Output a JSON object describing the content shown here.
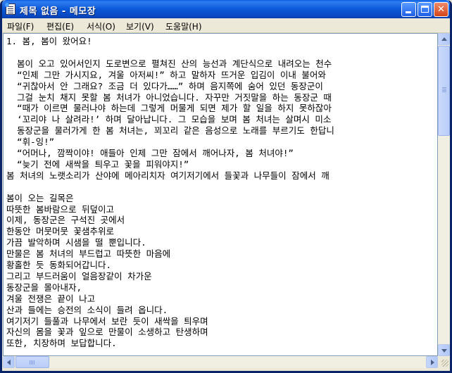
{
  "window": {
    "title": "제목 없음 - 메모장",
    "buttons": {
      "minimize": "",
      "maximize": "",
      "close": "✕"
    }
  },
  "menu": [
    {
      "label": "파일(F)"
    },
    {
      "label": "편집(E)"
    },
    {
      "label": "서식(O)"
    },
    {
      "label": "보기(V)"
    },
    {
      "label": "도움말(H)"
    }
  ],
  "editor": {
    "lines": [
      "1. 봄, 봄이 왔어요!",
      "",
      "  봄이 오고 있어서인지 도로변으로 펼쳐진 산의 능선과 계단식으로 내려오는 천수",
      "  “인제 그만 가시지요, 겨울 아저씨!” 하고 말하자 뜨거운 입김이 이내 불어와 ",
      "  “귀찮아서 안 그래요? 조금 더 있다가……” 하며 음지쪽에 숨어 있던 동장군이",
      "  그걸 눈치 채지 못할 봄 처녀가 아니었습니다. 자꾸만 거짓말을 하는 동장군 때",
      "  “때가 이르면 물러나야 하는데 그렇게 머물게 되면 제가 할 일을 하지 못하잖아",
      "  ‘꼬리야 나 살려라!’ 하며 달아납니다. 그 모습을 보며 봄 처녀는 살며시 미소",
      "  동장군을 물러가게 한 봄 처녀는, 꾀꼬리 같은 음성으로 노래를 부르기도 한답니",
      "  “휘-잉!”",
      "  “어머나, 깜짝이야! 애들아 인제 그만 잠에서 깨어나자, 봄 처녀야!”",
      "  “늦기 전에 새싹을 틔우고 꽃을 피워야지!”",
      "봄 처녀의 노랫소리가 산야에 메아리치자 여기저기에서 들꽃과 나무들이 잠에서 깨",
      "",
      "봄이 오는 길목은",
      "따뜻한 봄바람으로 뒤덮이고",
      "이제, 동장군은 구석진 곳에서",
      "한동안 머뭇머뭇 꽃샘추위로",
      "가끔 발악하며 시샘을 떨 뿐입니다.",
      "만물은 봄 처녀의 부드럽고 따뜻한 마음에",
      "황홀한 듯 동화되어갑니다.",
      "그리고 부드러움이 얼음장같이 차가운",
      "동장군을 몰아내자,",
      "겨울 전쟁은 끝이 나고",
      "산과 들에는 승전의 소식이 들려 옵니다.",
      "여기저기 들풀과 나무에서 보란 듯이 새싹을 틔우며",
      "자신의 몸을 꽃과 잎으로 만물이 소생하고 탄생하며",
      "또한, 치장하며 보답합니다."
    ]
  },
  "icons": {
    "app": "notepad-icon",
    "scroll_up": "arrow-up-icon",
    "scroll_down": "arrow-down-icon",
    "scroll_left": "arrow-left-icon",
    "scroll_right": "arrow-right-icon"
  },
  "colors": {
    "titlebar": "#0a58d8",
    "close_button": "#d2461a",
    "editor_bg": "#ffffff",
    "chrome_bg": "#ece9d8"
  }
}
